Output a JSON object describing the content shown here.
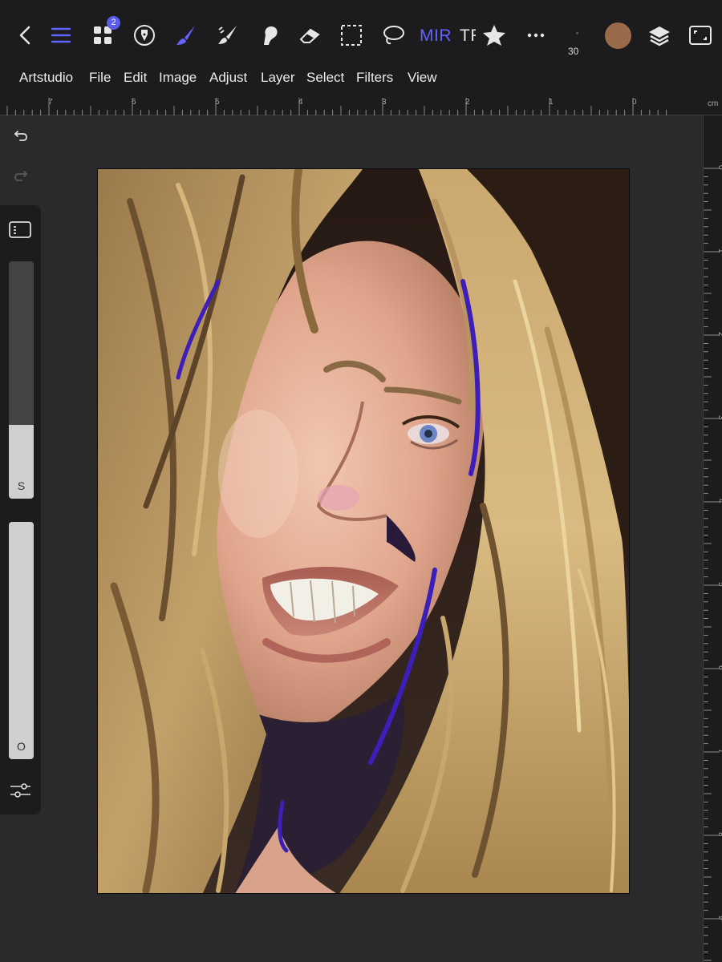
{
  "toolbar": {
    "tools": [
      {
        "name": "back",
        "icon": "chevron-left-icon"
      },
      {
        "name": "menu",
        "icon": "hamburger-menu-icon"
      },
      {
        "name": "gallery",
        "icon": "grid-icon",
        "badge": "2"
      },
      {
        "name": "pen",
        "icon": "pen-nib-icon"
      },
      {
        "name": "brush",
        "icon": "paintbrush-icon",
        "active": true
      },
      {
        "name": "smudge",
        "icon": "smudge-brush-icon"
      },
      {
        "name": "blender",
        "icon": "blend-icon"
      },
      {
        "name": "eraser",
        "icon": "eraser-icon"
      },
      {
        "name": "selection",
        "icon": "dashed-rectangle-icon"
      },
      {
        "name": "lasso",
        "icon": "lasso-icon"
      },
      {
        "name": "favorites",
        "icon": "star-icon"
      },
      {
        "name": "more",
        "icon": "ellipsis-icon"
      },
      {
        "name": "layers",
        "icon": "layers-icon"
      },
      {
        "name": "fullscreen",
        "icon": "fullscreen-icon"
      }
    ],
    "mirror_label": "MIR",
    "transform_label": "TF",
    "gallery_badge": "2",
    "brush_size": "30",
    "current_color": "#9a6b4b",
    "accent_color": "#6264ff"
  },
  "menu": {
    "items": [
      "Artstudio",
      "File",
      "Edit",
      "Image",
      "Adjust",
      "Layer",
      "Select",
      "Filters",
      "View"
    ]
  },
  "ruler": {
    "unit": "cm",
    "top_labels": [
      "7",
      "6",
      "5",
      "4",
      "3",
      "2",
      "1",
      "0"
    ],
    "right_labels": [
      "0",
      "1",
      "2",
      "3",
      "4",
      "5",
      "6",
      "7",
      "8",
      "9"
    ]
  },
  "sidebar": {
    "size_slider": {
      "label": "S",
      "fill_fraction": 0.31
    },
    "opacity_slider": {
      "label": "O",
      "fill_fraction": 1.0
    }
  }
}
